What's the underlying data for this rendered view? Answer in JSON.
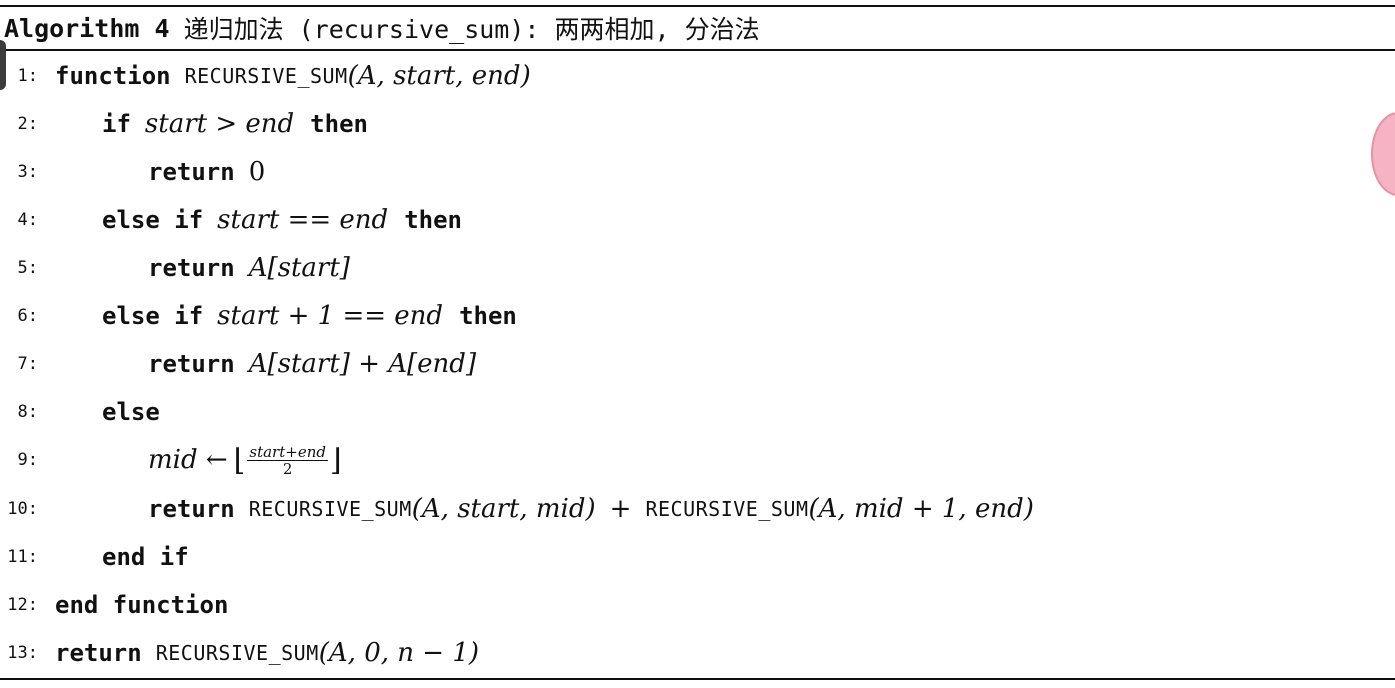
{
  "header": {
    "label": "Algorithm 4",
    "title": "递归加法 (recursive_sum): 两两相加, 分治法"
  },
  "lines": [
    {
      "num": "1:",
      "parts": [
        "function",
        "RECURSIVE_SUM",
        "(A, start, end)"
      ]
    },
    {
      "num": "2:",
      "parts": [
        "if",
        "start > end",
        "then"
      ]
    },
    {
      "num": "3:",
      "parts": [
        "return",
        "0"
      ]
    },
    {
      "num": "4:",
      "parts": [
        "else if",
        "start == end",
        "then"
      ]
    },
    {
      "num": "5:",
      "parts": [
        "return",
        "A[start]"
      ]
    },
    {
      "num": "6:",
      "parts": [
        "else if",
        "start + 1 == end",
        "then"
      ]
    },
    {
      "num": "7:",
      "parts": [
        "return",
        "A[start] + A[end]"
      ]
    },
    {
      "num": "8:",
      "parts": [
        "else"
      ]
    },
    {
      "num": "9:",
      "parts": [
        "mid ←",
        "start+end",
        "2"
      ]
    },
    {
      "num": "10:",
      "parts": [
        "return",
        "RECURSIVE_SUM",
        "(A, start, mid)",
        "+",
        "RECURSIVE_SUM",
        "(A, mid + 1, end)"
      ]
    },
    {
      "num": "11:",
      "parts": [
        "end if"
      ]
    },
    {
      "num": "12:",
      "parts": [
        "end function"
      ]
    },
    {
      "num": "13:",
      "parts": [
        "return",
        "RECURSIVE_SUM",
        "(A, 0, n − 1)"
      ]
    }
  ]
}
